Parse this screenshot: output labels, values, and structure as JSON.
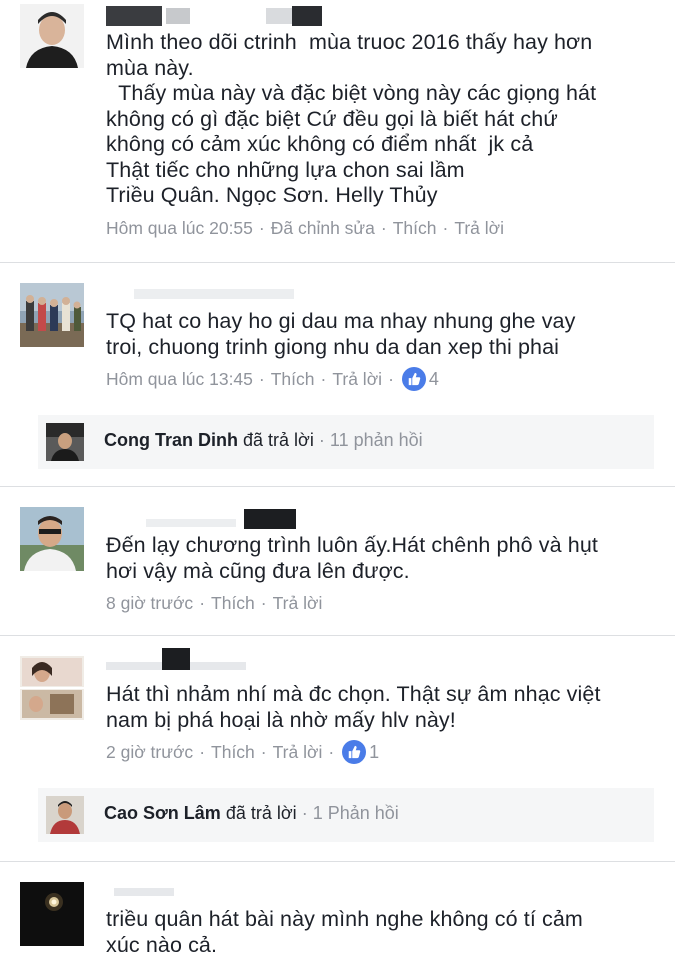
{
  "comments": [
    {
      "text": "Mình theo dõi ctrinh  mùa truoc 2016 thấy hay hơn\nmùa này.\n  Thấy mùa này và đặc biệt vòng này các giọng hát\nkhông có gì đặc biệt Cứ đều gọi là biết hát chứ\nkhông có cảm xúc không có điểm nhất  jk cả\nThật tiếc cho những lựa chon sai lầm\nTriều Quân. Ngọc Sơn. Helly Thủy",
      "time": "Hôm qua lúc 20:55",
      "edited": "Đã chỉnh sửa",
      "like": "Thích",
      "reply": "Trả lời"
    },
    {
      "text": "TQ hat co hay ho gi dau ma nhay nhung ghe vay\ntroi, chuong trinh giong nhu da dan xep thi phai",
      "time": "Hôm qua lúc 13:45",
      "like": "Thích",
      "reply": "Trả lời",
      "like_count": "4",
      "replies": {
        "name": "Cong Tran Dinh",
        "verb": "đã trả lời",
        "count": "11 phản hồi"
      }
    },
    {
      "text": "Đến lạy chương trình luôn ấy.Hát chênh phô và hụt\nhơi vậy mà cũng đưa lên được.",
      "time": "8 giờ trước",
      "like": "Thích",
      "reply": "Trả lời"
    },
    {
      "text": "Hát thì nhảm nhí mà đc chọn. Thật sự âm nhạc việt\nnam bị phá hoại là nhờ mấy hlv này!",
      "time": "2 giờ trước",
      "like": "Thích",
      "reply": "Trả lời",
      "like_count": "1",
      "replies": {
        "name": "Cao Sơn Lâm",
        "verb": "đã trả lời",
        "count": "1 Phản hồi"
      }
    },
    {
      "text": "triều quân hát bài này mình nghe không có tí cảm\nxúc nào cả."
    }
  ],
  "separator": "·",
  "colors": {
    "text": "#1d2129",
    "meta": "#90949c",
    "like_badge": "#4a7ce8",
    "reply_box": "#f5f6f7",
    "divider": "#dddfe2"
  }
}
